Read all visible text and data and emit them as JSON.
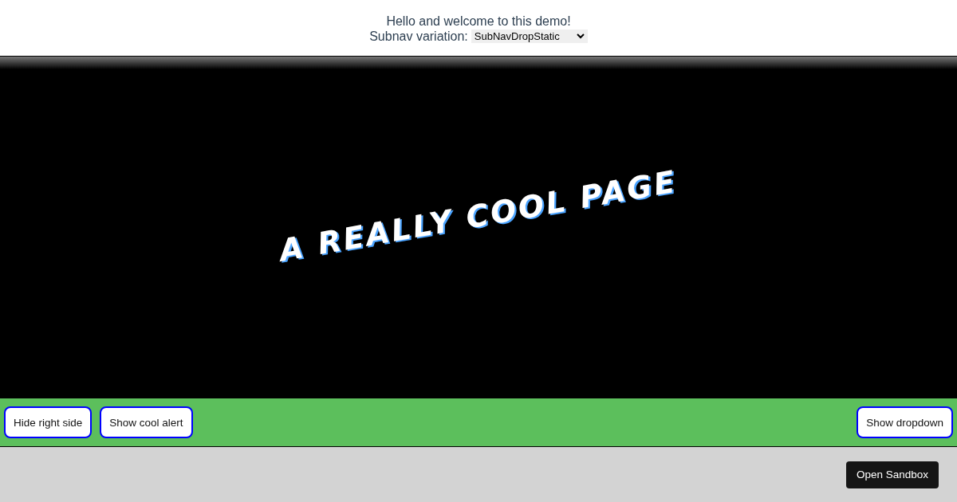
{
  "header": {
    "greeting": "Hello and welcome to this demo!",
    "subnav_label": "Subnav variation:",
    "subnav_value": "SubNavDropStatic"
  },
  "hero": {
    "title": "A REALLY COOL PAGE"
  },
  "action_bar": {
    "left_buttons": [
      "Hide right side",
      "Show cool alert"
    ],
    "right_buttons": [
      "Show dropdown"
    ]
  },
  "footer": {
    "button": "Open Sandbox"
  }
}
